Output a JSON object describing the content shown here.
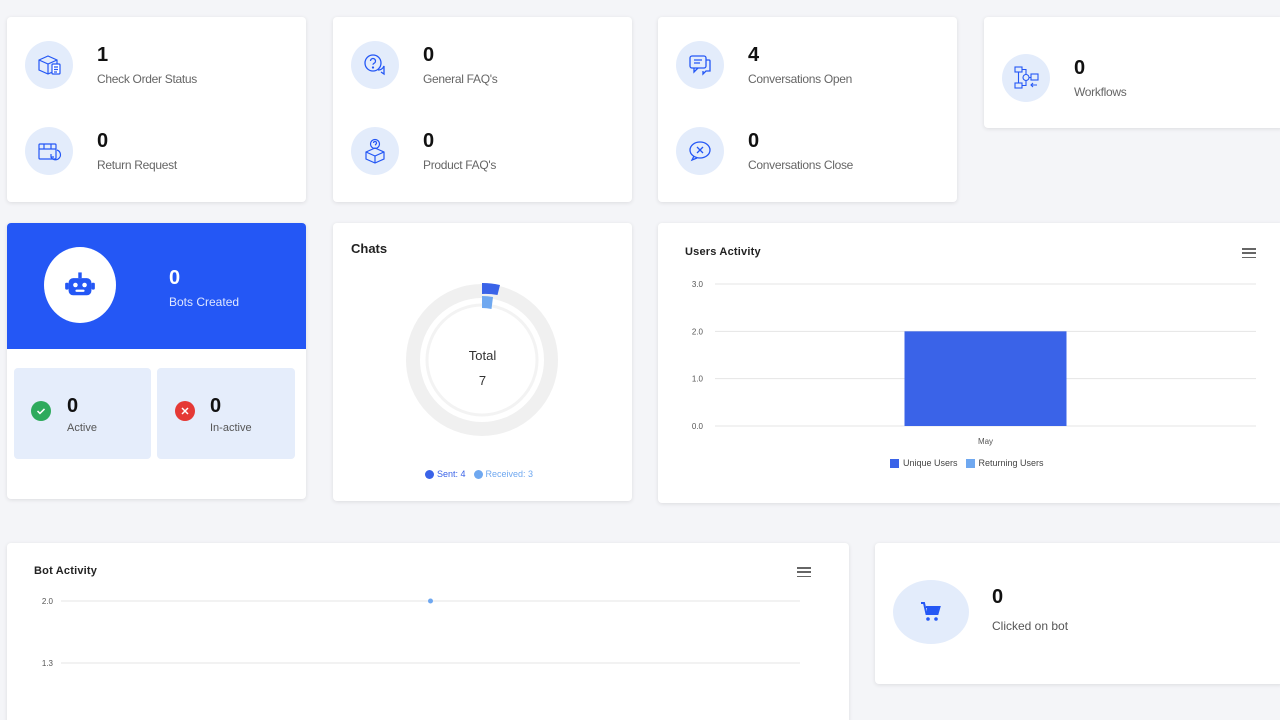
{
  "stats": {
    "check_order": {
      "value": "1",
      "label": "Check Order Status"
    },
    "return_request": {
      "value": "0",
      "label": "Return Request"
    },
    "general_faq": {
      "value": "0",
      "label": "General FAQ's"
    },
    "product_faq": {
      "value": "0",
      "label": "Product FAQ's"
    },
    "conv_open": {
      "value": "4",
      "label": "Conversations Open"
    },
    "conv_close": {
      "value": "0",
      "label": "Conversations Close"
    },
    "workflows": {
      "value": "0",
      "label": "Workflows"
    },
    "clicked_on_bot": {
      "value": "0",
      "label": "Clicked on bot"
    }
  },
  "bots": {
    "created_value": "0",
    "created_label": "Bots Created",
    "active_value": "0",
    "active_label": "Active",
    "inactive_value": "0",
    "inactive_label": "In-active"
  },
  "chats": {
    "title": "Chats",
    "center_label": "Total",
    "center_value": "7",
    "legend_sent": "Sent: 4",
    "legend_received": "Received: 3"
  },
  "colors": {
    "primary": "#2457f5",
    "unique": "#3a63e8",
    "returning": "#6fa8f0",
    "active_green": "#2eaa5c",
    "inactive_red": "#e53935",
    "icon_bg": "#e3ecfb",
    "bot_tile_bg": "#e5edfb"
  },
  "chart_data": [
    {
      "type": "bar",
      "title": "Users Activity",
      "categories": [
        "May"
      ],
      "series": [
        {
          "name": "Unique Users",
          "values": [
            2
          ]
        },
        {
          "name": "Returning Users",
          "values": [
            0
          ]
        }
      ],
      "yticks": [
        "3.0",
        "2.0",
        "1.0",
        "0.0"
      ],
      "ylim": [
        0,
        3
      ],
      "grid": true,
      "legend": "bottom"
    },
    {
      "type": "line",
      "title": "Bot Activity",
      "yticks": [
        "2.0",
        "1.3"
      ],
      "points": [
        {
          "y": 2.0
        }
      ],
      "grid": true
    }
  ]
}
